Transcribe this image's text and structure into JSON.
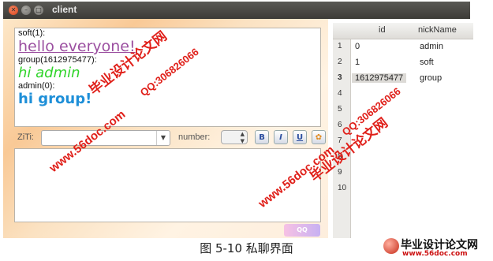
{
  "window": {
    "title": "client"
  },
  "chat": {
    "messages": [
      {
        "sender": "soft(1):",
        "text": "hello everyone!",
        "color": "#9b4fa0"
      },
      {
        "sender": "group(1612975477):",
        "text": "hi admin",
        "color": "#2fd42a"
      },
      {
        "sender": "admin(0):",
        "text": "hi group!",
        "color": "#1e8fd8"
      }
    ]
  },
  "toolbar": {
    "font_label": "ZiTi:",
    "font_value": "",
    "size_label": "number:",
    "size_value": "",
    "bold": "B",
    "italic": "I",
    "underline": "U",
    "palette_icon": "palette-icon"
  },
  "table": {
    "headers": [
      "id",
      "nickName"
    ],
    "rows": [
      {
        "num": "1",
        "id": "0",
        "name": "admin"
      },
      {
        "num": "2",
        "id": "1",
        "name": "soft"
      },
      {
        "num": "3",
        "id": "1612975477",
        "name": "group"
      },
      {
        "num": "4",
        "id": "",
        "name": ""
      },
      {
        "num": "5",
        "id": "",
        "name": ""
      },
      {
        "num": "6",
        "id": "",
        "name": ""
      },
      {
        "num": "7",
        "id": "",
        "name": ""
      },
      {
        "num": "8",
        "id": "",
        "name": ""
      },
      {
        "num": "9",
        "id": "",
        "name": ""
      },
      {
        "num": "10",
        "id": "",
        "name": ""
      }
    ]
  },
  "caption": "图 5-10   私聊界面",
  "watermarks": {
    "a": "毕业设计论文网",
    "b": "QQ:306826066",
    "c": "www.56doc.com"
  },
  "brand": {
    "name": "毕业设计论文网",
    "url": "www.56doc.com"
  }
}
